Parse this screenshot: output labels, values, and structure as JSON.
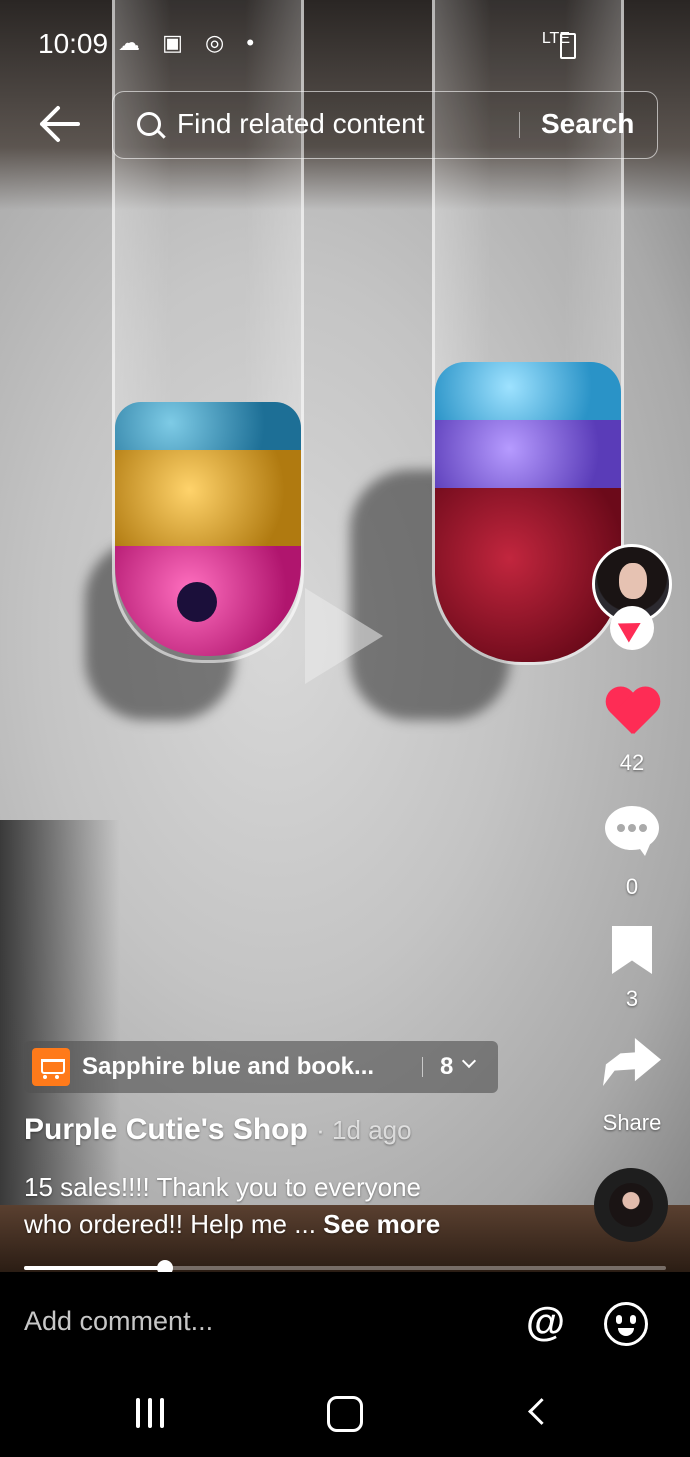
{
  "status_bar": {
    "time": "10:09",
    "network": "LTE"
  },
  "search": {
    "placeholder": "Find related content",
    "button": "Search"
  },
  "rail": {
    "likes": "42",
    "comments": "0",
    "bookmarks": "3",
    "share_label": "Share"
  },
  "product": {
    "title": "Sapphire blue and book...",
    "count": "8"
  },
  "post": {
    "author": "Purple Cutie's Shop",
    "time_ago": "· 1d ago",
    "caption_line1": "15 sales!!!! Thank you to everyone",
    "caption_line2": "who ordered!! Help me ...",
    "see_more": "See more",
    "progress": 0.22
  },
  "comment_bar": {
    "placeholder": "Add comment..."
  },
  "colors": {
    "like": "#fe2c55",
    "cart": "#ff7a1a"
  },
  "icons": [
    "back-arrow-icon",
    "search-icon",
    "play-icon",
    "heart-icon",
    "comment-icon",
    "bookmark-icon",
    "share-icon",
    "cart-icon",
    "chevron-down-icon",
    "at-icon",
    "emoji-icon",
    "recent-apps-icon",
    "home-icon",
    "nav-back-icon"
  ]
}
